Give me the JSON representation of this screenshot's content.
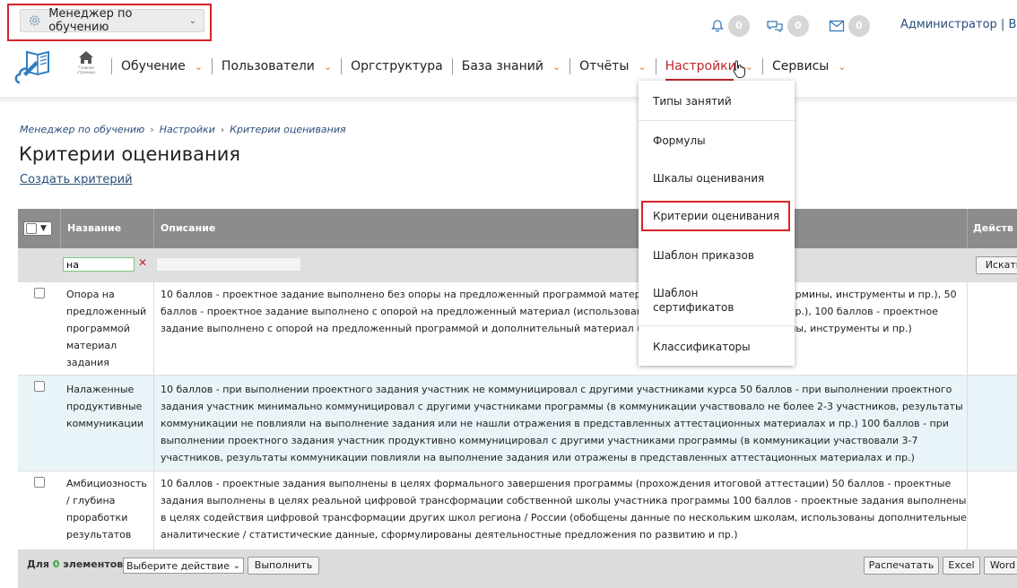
{
  "role_selector": {
    "label": "Менеджер по обучению",
    "icon": "gear-icon"
  },
  "header": {
    "notifications": {
      "bell_count": "0",
      "chat_count": "0",
      "mail_count": "0"
    },
    "user": "Администратор | Вы"
  },
  "nav": {
    "home_label": "Главная страница",
    "items": [
      {
        "label": "Обучение"
      },
      {
        "label": "Пользователи"
      },
      {
        "label": "Оргструктура"
      },
      {
        "label": "База знаний"
      },
      {
        "label": "Отчёты"
      },
      {
        "label": "Настройки"
      },
      {
        "label": "Сервисы"
      }
    ]
  },
  "settings_menu": {
    "items": [
      {
        "label": "Типы занятий"
      },
      {
        "label": "Формулы"
      },
      {
        "label": "Шкалы оценивания"
      },
      {
        "label": "Критерии оценивания"
      },
      {
        "label": "Шаблон приказов"
      },
      {
        "label": "Шаблон сертификатов"
      },
      {
        "label": "Классификаторы"
      }
    ]
  },
  "breadcrumb": {
    "items": [
      "Менеджер по обучению",
      "Настройки",
      "Критерии оценивания"
    ]
  },
  "page": {
    "title": "Критерии оценивания",
    "create_link": "Создать критерий"
  },
  "table": {
    "columns": {
      "name": "Название",
      "description": "Описание",
      "actions": "Действ"
    },
    "filter": {
      "name_value": "на",
      "search_button": "Искать"
    },
    "rows": [
      {
        "name": "Опора на предложенный программой материал задания",
        "description": "10 баллов - проектное задание выполнено без опоры на предложенный программой материал (использованы другие термины, инструменты и пр.), 50 баллов - проектное задание выполнено с опорой на предложенный материал (использованы термины, инструменты и пр.), 100 баллов - проектное задание выполнено с опорой на предложенный программой и дополнительный материал (использованы другие термины, инструменты и пр.)"
      },
      {
        "name": "Налаженные продуктивные коммуникации",
        "description": "10 баллов - при выполнении проектного задания участник не коммуницировал с другими участниками курса 50 баллов - при выполнении проектного задания участник минимально коммуницировал с другими участниками программы (в коммуникации участвовало не более 2-3 участников, результаты коммуникации не повлияли на выполнение задания или не нашли отражения в представленных аттестационных материалах и пр.) 100 баллов - при выполнении проектного задания участник продуктивно коммуницировал с другими участниками программы (в коммуникации участвовали 3-7 участников, результаты коммуникации повлияли на выполнение задания или отражены в представленных аттестационных материалах и пр.)"
      },
      {
        "name": "Амбициозность / глубина проработки результатов",
        "description": "10 баллов - проектные задания выполнены в целях формального завершения программы (прохождения итоговой аттестации) 50 баллов - проектные задания выполнены в целях реальной цифровой трансформации собственной школы участника программы 100 баллов - проектные задания выполнены в целях содействия цифровой трансформации других школ региона / России (обобщены данные по нескольким школам, использованы дополнительные аналитические / статистические данные, сформулированы деятельностные предложения по развитию и пр.)"
      }
    ]
  },
  "footer": {
    "for_prefix": "Для",
    "count": "0",
    "for_suffix": "элементов:",
    "action_select": "Выберите действие",
    "execute": "Выполнить",
    "print": "Распечатать",
    "excel": "Excel",
    "word": "Word"
  },
  "colors": {
    "accent": "#c0262c",
    "link": "#2a4e7a",
    "header_bg": "#8c8c8c",
    "row_alt": "#e9f4f8",
    "badge": "#d6d6d6"
  }
}
